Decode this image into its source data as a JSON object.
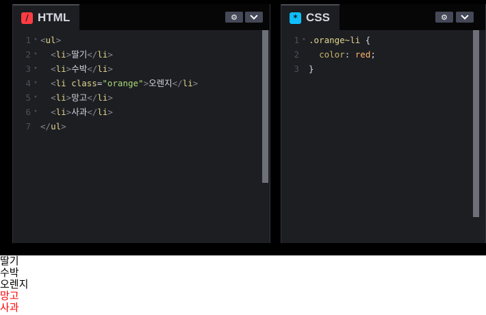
{
  "html_pane": {
    "title": "HTML",
    "icon": "html-icon",
    "icon_glyph": "/",
    "icon_color": "#ff3c41",
    "lines": [
      {
        "n": "1",
        "fold": "▾",
        "code": [
          {
            "t": "<",
            "c": "br"
          },
          {
            "t": "ul",
            "c": "tag"
          },
          {
            "t": ">",
            "c": "br"
          }
        ]
      },
      {
        "n": "2",
        "fold": "▾",
        "code": [
          {
            "t": "  ",
            "c": ""
          },
          {
            "t": "<",
            "c": "br"
          },
          {
            "t": "li",
            "c": "tag"
          },
          {
            "t": ">",
            "c": "br"
          },
          {
            "t": "딸기",
            "c": ""
          },
          {
            "t": "</",
            "c": "br"
          },
          {
            "t": "li",
            "c": "tag"
          },
          {
            "t": ">",
            "c": "br"
          }
        ]
      },
      {
        "n": "3",
        "fold": "▾",
        "code": [
          {
            "t": "  ",
            "c": ""
          },
          {
            "t": "<",
            "c": "br"
          },
          {
            "t": "li",
            "c": "tag"
          },
          {
            "t": ">",
            "c": "br"
          },
          {
            "t": "수박",
            "c": ""
          },
          {
            "t": "</",
            "c": "br"
          },
          {
            "t": "li",
            "c": "tag"
          },
          {
            "t": ">",
            "c": "br"
          }
        ]
      },
      {
        "n": "4",
        "fold": "▾",
        "code": [
          {
            "t": "  ",
            "c": ""
          },
          {
            "t": "<",
            "c": "br"
          },
          {
            "t": "li",
            "c": "tag"
          },
          {
            "t": " ",
            "c": ""
          },
          {
            "t": "class",
            "c": "attr"
          },
          {
            "t": "=",
            "c": ""
          },
          {
            "t": "\"orange\"",
            "c": "str"
          },
          {
            "t": ">",
            "c": "br"
          },
          {
            "t": "오렌지",
            "c": ""
          },
          {
            "t": "</",
            "c": "br"
          },
          {
            "t": "li",
            "c": "tag"
          },
          {
            "t": ">",
            "c": "br"
          }
        ]
      },
      {
        "n": "5",
        "fold": "▾",
        "code": [
          {
            "t": "  ",
            "c": ""
          },
          {
            "t": "<",
            "c": "br"
          },
          {
            "t": "li",
            "c": "tag"
          },
          {
            "t": ">",
            "c": "br"
          },
          {
            "t": "망고",
            "c": ""
          },
          {
            "t": "</",
            "c": "br"
          },
          {
            "t": "li",
            "c": "tag"
          },
          {
            "t": ">",
            "c": "br"
          }
        ]
      },
      {
        "n": "6",
        "fold": "▾",
        "code": [
          {
            "t": "  ",
            "c": ""
          },
          {
            "t": "<",
            "c": "br"
          },
          {
            "t": "li",
            "c": "tag"
          },
          {
            "t": ">",
            "c": "br"
          },
          {
            "t": "사과",
            "c": ""
          },
          {
            "t": "</",
            "c": "br"
          },
          {
            "t": "li",
            "c": "tag"
          },
          {
            "t": ">",
            "c": "br"
          }
        ]
      },
      {
        "n": "7",
        "fold": "",
        "code": [
          {
            "t": "</",
            "c": "br"
          },
          {
            "t": "ul",
            "c": "tag"
          },
          {
            "t": ">",
            "c": "br"
          }
        ]
      }
    ]
  },
  "css_pane": {
    "title": "CSS",
    "icon": "css-icon",
    "icon_glyph": "*",
    "icon_color": "#0ebeff",
    "lines": [
      {
        "n": "1",
        "fold": "▾",
        "code": [
          {
            "t": ".orange~li",
            "c": "tag"
          },
          {
            "t": " {",
            "c": ""
          }
        ]
      },
      {
        "n": "2",
        "fold": "",
        "code": [
          {
            "t": "  ",
            "c": ""
          },
          {
            "t": "color",
            "c": "prop"
          },
          {
            "t": ": ",
            "c": ""
          },
          {
            "t": "red",
            "c": "val"
          },
          {
            "t": ";",
            "c": ""
          }
        ]
      },
      {
        "n": "3",
        "fold": "",
        "code": [
          {
            "t": "}",
            "c": ""
          }
        ]
      }
    ]
  },
  "header_buttons": {
    "settings_icon": "gear-icon",
    "settings_glyph": "⚙",
    "dropdown_icon": "chevron-down-icon"
  },
  "result": {
    "items": [
      {
        "text": "딸기",
        "color": "#000000"
      },
      {
        "text": "수박",
        "color": "#000000"
      },
      {
        "text": "오렌지",
        "color": "#000000"
      },
      {
        "text": "망고",
        "color": "#ff0000"
      },
      {
        "text": "사과",
        "color": "#ff0000"
      }
    ]
  },
  "colors": {
    "editor_bg": "#1d1e22",
    "chrome_bg": "#000000",
    "tag": "#e1d68f",
    "bracket": "#888a92",
    "string": "#a9dc76",
    "value": "#ffb36b"
  }
}
